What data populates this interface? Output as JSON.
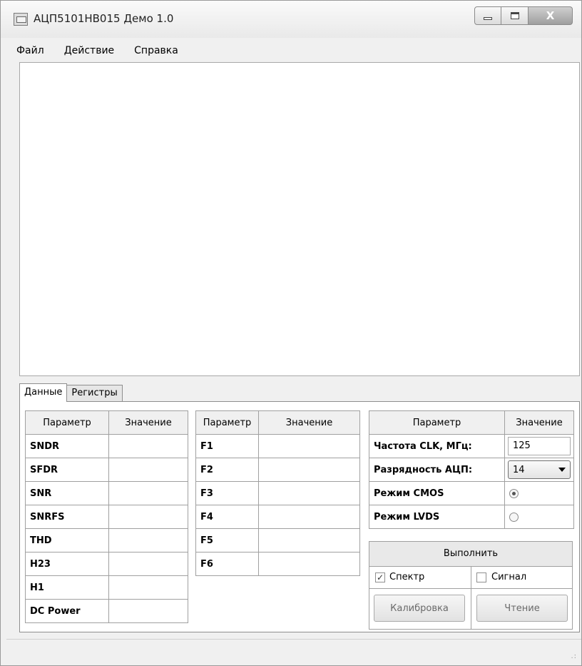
{
  "window": {
    "title": "АЦП5101НВ015 Демо 1.0",
    "close_label": "X"
  },
  "menu": {
    "items": [
      "Файл",
      "Действие",
      "Справка"
    ]
  },
  "tabs": [
    {
      "label": "Данные",
      "active": true
    },
    {
      "label": "Регистры",
      "active": false
    }
  ],
  "table1": {
    "headers": [
      "Параметр",
      "Значение"
    ],
    "rows": [
      "SNDR",
      "SFDR",
      "SNR",
      "SNRFS",
      "THD",
      "H23",
      "H1",
      "DC Power"
    ]
  },
  "table2": {
    "headers": [
      "Параметр",
      "Значение"
    ],
    "rows": [
      "F1",
      "F2",
      "F3",
      "F4",
      "F5",
      "F6"
    ]
  },
  "settings": {
    "headers": [
      "Параметр",
      "Значение"
    ],
    "clk_label": "Частота CLK, МГц:",
    "clk_value": "125",
    "bits_label": "Разрядность АЦП:",
    "bits_value": "14",
    "cmos_label": "Режим CMOS",
    "cmos_selected": true,
    "lvds_label": "Режим LVDS",
    "lvds_selected": false
  },
  "execute": {
    "header": "Выполнить",
    "spectrum_label": "Спектр",
    "spectrum_checked": true,
    "signal_label": "Сигнал",
    "signal_checked": false,
    "calibrate_label": "Калибровка",
    "read_label": "Чтение"
  },
  "colors": {
    "panel_bg": "#f0f0f0",
    "header_bg": "#f0f0f0",
    "border": "#a0a0a0"
  },
  "icons": [
    "app-icon",
    "minimize-icon",
    "maximize-icon",
    "close-icon",
    "chevron-down-icon",
    "resize-grip-icon"
  ]
}
